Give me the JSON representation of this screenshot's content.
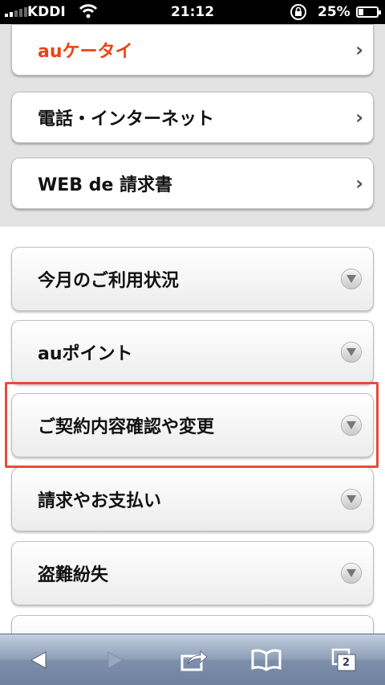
{
  "status_bar": {
    "carrier": "KDDI",
    "time": "21:12",
    "battery_percent": "25%",
    "battery_level": 0.25
  },
  "top_links": [
    {
      "label": "auケータイ",
      "color": "#e84513"
    },
    {
      "label": "電話・インターネット"
    },
    {
      "label": "WEB de 請求書"
    }
  ],
  "menu_items": [
    {
      "label": "今月のご利用状況"
    },
    {
      "label": "auポイント"
    },
    {
      "label": "ご契約内容確認や変更"
    },
    {
      "label": "請求やお支払い"
    },
    {
      "label": "盗難紛失"
    }
  ],
  "toolbar": {
    "back_icon": "back-arrow-icon",
    "forward_icon": "forward-arrow-icon",
    "share_icon": "share-icon",
    "bookmarks_icon": "bookmarks-icon",
    "tabs_icon": "tabs-icon",
    "tabs_count": "2"
  },
  "colors": {
    "accent_orange": "#e84513",
    "highlight_red": "#e74c3c",
    "toolbar_blue": "#8f9fb8"
  }
}
